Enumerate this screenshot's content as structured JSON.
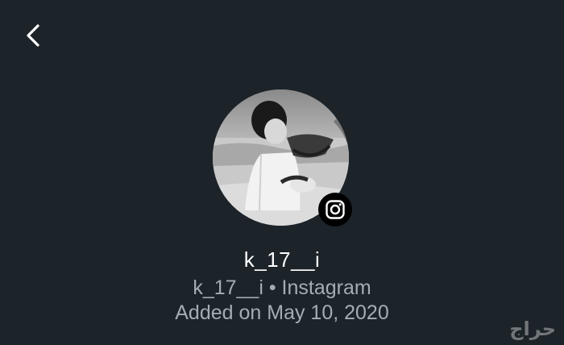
{
  "header": {
    "back_icon": "chevron-left-icon"
  },
  "profile": {
    "avatar_icon": "profile-photo",
    "badge_icon": "instagram-icon",
    "username": "k_17__i",
    "source_line": "k_17__i • Instagram",
    "added_line": "Added on May 10, 2020"
  },
  "watermark": {
    "text": "حراج"
  },
  "colors": {
    "background": "#1c2329",
    "primary_text": "#ffffff",
    "secondary_text": "#a3adb5",
    "badge_background": "#000000"
  }
}
